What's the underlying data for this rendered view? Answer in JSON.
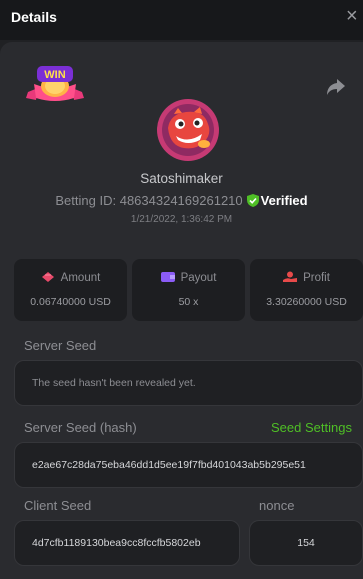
{
  "header": {
    "title": "Details",
    "close_glyph": "×"
  },
  "badge": {
    "text": "WIN"
  },
  "user": {
    "name": "Satoshimaker",
    "betting_id_label": "Betting ID:",
    "betting_id": "48634324169261210",
    "verified_label": "Verified",
    "timestamp": "1/21/2022, 1:36:42 PM"
  },
  "stats": [
    {
      "label": "Amount",
      "value": "0.06740000 USD",
      "icon": "coins-icon"
    },
    {
      "label": "Payout",
      "value": "50 x",
      "icon": "wallet-icon"
    },
    {
      "label": "Profit",
      "value": "3.30260000 USD",
      "icon": "hand-coins-icon"
    }
  ],
  "server_seed": {
    "label": "Server Seed",
    "value": "The seed hasn't been revealed yet."
  },
  "server_seed_hash": {
    "label": "Server Seed (hash)",
    "link": "Seed Settings",
    "value": "e2ae67c28da75eba46dd1d5ee19f7fbd401043ab5b295e51"
  },
  "client_seed": {
    "label": "Client Seed",
    "value": "4d7cfb1189130bea9cc8fccfb5802eb"
  },
  "nonce": {
    "label": "nonce",
    "value": "154"
  },
  "colors": {
    "background": "#202124",
    "panel": "#2a2b2f",
    "accent_green": "#4fbf26",
    "amount_icon": "#e84a6a",
    "payout_icon": "#8b5cf6",
    "profit_icon": "#e84a4a"
  }
}
